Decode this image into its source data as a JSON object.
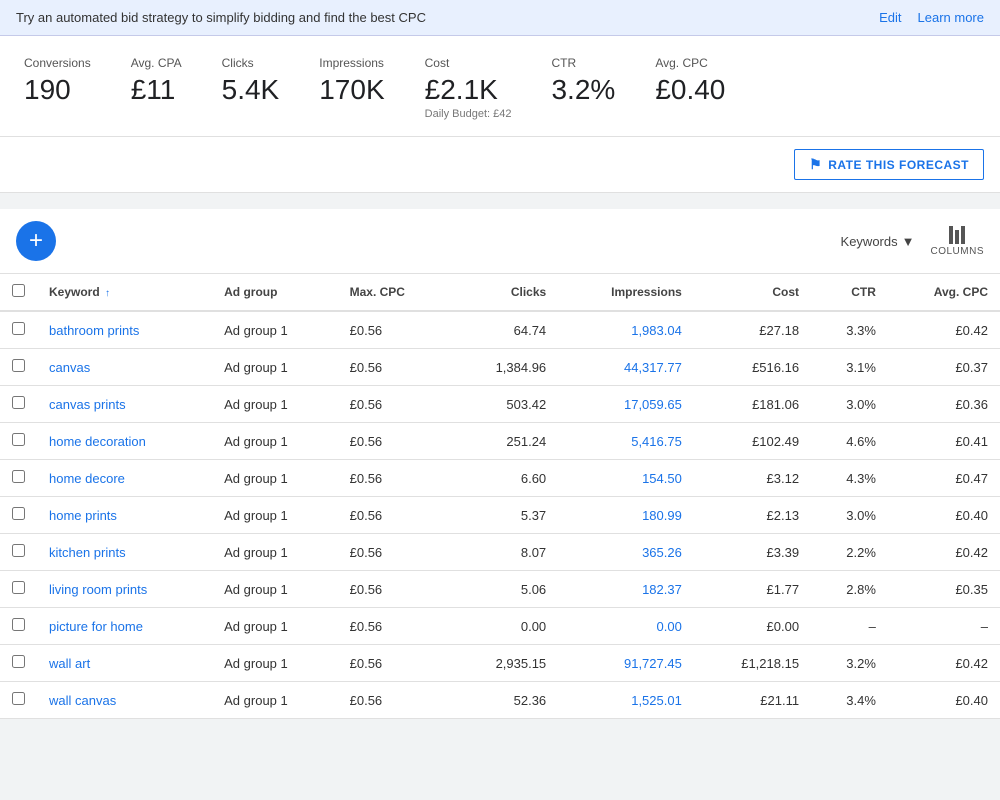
{
  "banner": {
    "text": "Try an automated bid strategy to simplify bidding and find the best CPC",
    "edit_label": "Edit",
    "learn_more_label": "Learn more"
  },
  "stats": [
    {
      "label": "Conversions",
      "value": "190",
      "sub": ""
    },
    {
      "label": "Avg. CPA",
      "value": "£11",
      "sub": ""
    },
    {
      "label": "Clicks",
      "value": "5.4K",
      "sub": ""
    },
    {
      "label": "Impressions",
      "value": "170K",
      "sub": ""
    },
    {
      "label": "Cost",
      "value": "£2.1K",
      "sub": "Daily Budget: £42"
    },
    {
      "label": "CTR",
      "value": "3.2%",
      "sub": ""
    },
    {
      "label": "Avg. CPC",
      "value": "£0.40",
      "sub": ""
    }
  ],
  "forecast_btn": "RATE THIS FORECAST",
  "toolbar": {
    "add_label": "+",
    "keywords_label": "Keywords",
    "columns_label": "COLUMNS"
  },
  "table": {
    "headers": [
      "",
      "Keyword",
      "Ad group",
      "Max. CPC",
      "Clicks",
      "Impressions",
      "Cost",
      "CTR",
      "Avg. CPC"
    ],
    "rows": [
      {
        "keyword": "bathroom prints",
        "ad_group": "Ad group 1",
        "max_cpc": "£0.56",
        "clicks": "64.74",
        "impressions": "1,983.04",
        "cost": "£27.18",
        "ctr": "3.3%",
        "avg_cpc": "£0.42"
      },
      {
        "keyword": "canvas",
        "ad_group": "Ad group 1",
        "max_cpc": "£0.56",
        "clicks": "1,384.96",
        "impressions": "44,317.77",
        "cost": "£516.16",
        "ctr": "3.1%",
        "avg_cpc": "£0.37"
      },
      {
        "keyword": "canvas prints",
        "ad_group": "Ad group 1",
        "max_cpc": "£0.56",
        "clicks": "503.42",
        "impressions": "17,059.65",
        "cost": "£181.06",
        "ctr": "3.0%",
        "avg_cpc": "£0.36"
      },
      {
        "keyword": "home decoration",
        "ad_group": "Ad group 1",
        "max_cpc": "£0.56",
        "clicks": "251.24",
        "impressions": "5,416.75",
        "cost": "£102.49",
        "ctr": "4.6%",
        "avg_cpc": "£0.41"
      },
      {
        "keyword": "home decore",
        "ad_group": "Ad group 1",
        "max_cpc": "£0.56",
        "clicks": "6.60",
        "impressions": "154.50",
        "cost": "£3.12",
        "ctr": "4.3%",
        "avg_cpc": "£0.47"
      },
      {
        "keyword": "home prints",
        "ad_group": "Ad group 1",
        "max_cpc": "£0.56",
        "clicks": "5.37",
        "impressions": "180.99",
        "cost": "£2.13",
        "ctr": "3.0%",
        "avg_cpc": "£0.40"
      },
      {
        "keyword": "kitchen prints",
        "ad_group": "Ad group 1",
        "max_cpc": "£0.56",
        "clicks": "8.07",
        "impressions": "365.26",
        "cost": "£3.39",
        "ctr": "2.2%",
        "avg_cpc": "£0.42"
      },
      {
        "keyword": "living room prints",
        "ad_group": "Ad group 1",
        "max_cpc": "£0.56",
        "clicks": "5.06",
        "impressions": "182.37",
        "cost": "£1.77",
        "ctr": "2.8%",
        "avg_cpc": "£0.35"
      },
      {
        "keyword": "picture for home",
        "ad_group": "Ad group 1",
        "max_cpc": "£0.56",
        "clicks": "0.00",
        "impressions": "0.00",
        "cost": "£0.00",
        "ctr": "–",
        "avg_cpc": "–"
      },
      {
        "keyword": "wall art",
        "ad_group": "Ad group 1",
        "max_cpc": "£0.56",
        "clicks": "2,935.15",
        "impressions": "91,727.45",
        "cost": "£1,218.15",
        "ctr": "3.2%",
        "avg_cpc": "£0.42"
      },
      {
        "keyword": "wall canvas",
        "ad_group": "Ad group 1",
        "max_cpc": "£0.56",
        "clicks": "52.36",
        "impressions": "1,525.01",
        "cost": "£21.11",
        "ctr": "3.4%",
        "avg_cpc": "£0.40"
      }
    ]
  }
}
